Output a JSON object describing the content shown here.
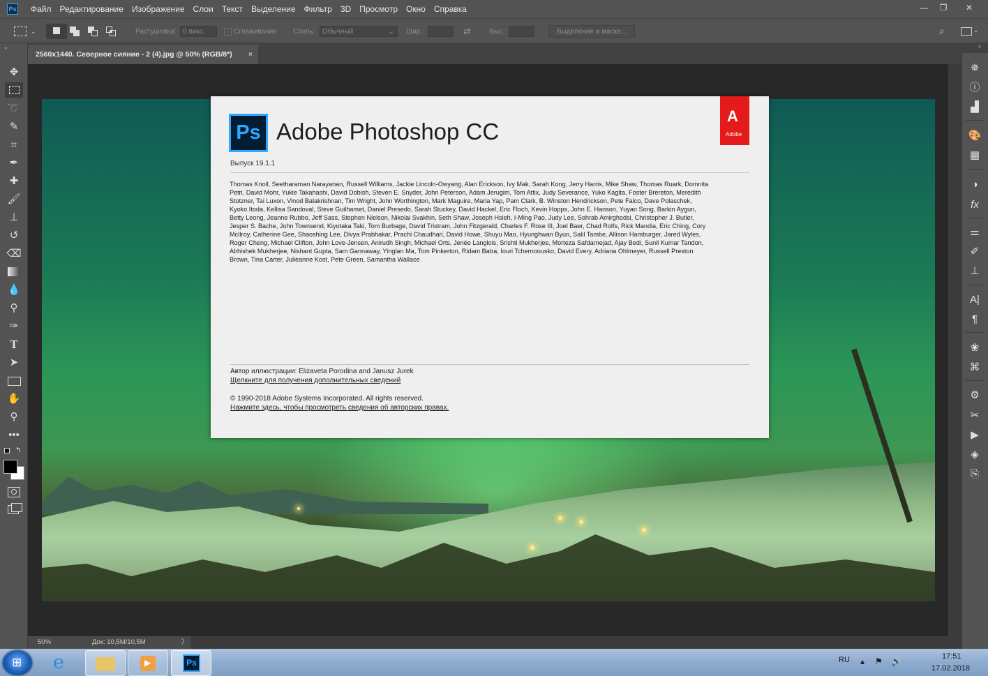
{
  "app": {
    "icon": "Ps",
    "accent": "#31a8ff"
  },
  "menu": [
    "Файл",
    "Редактирование",
    "Изображение",
    "Слои",
    "Текст",
    "Выделение",
    "Фильтр",
    "3D",
    "Просмотр",
    "Окно",
    "Справка"
  ],
  "window_controls": {
    "minimize": "—",
    "restore": "❐",
    "close": "✕"
  },
  "options": {
    "feather_label": "Растушевка:",
    "feather_value": "0 пикс.",
    "antialias_label": "Сглаживание",
    "style_label": "Стиль:",
    "style_value": "Обычный",
    "width_label": "Шир.:",
    "height_label": "Выс.:",
    "select_mask_label": "Выделение и маска..."
  },
  "document": {
    "tab_title": "2560x1440. Северное сияние - 2 (4).jpg @ 50% (RGB/8*)",
    "tab_close": "×"
  },
  "status": {
    "zoom": "50%",
    "doc_size": "Док: 10,5M/10,5M",
    "arrow": "〉"
  },
  "about": {
    "logo_text": "Ps",
    "title": "Adobe Photoshop CC",
    "adobe_text": "Adobe",
    "version": "Выпуск 19.1.1",
    "credits": "Thomas Knoll, Seetharaman Narayanan, Russell Williams, Jackie Lincoln-Owyang, Alan Erickson, Ivy Mak, Sarah Kong, Jerry Harris, Mike Shaw, Thomas Ruark, Domnita Petri, David Mohr, Yukie Takahashi, David Dobish, Steven E. Snyder, John Peterson, Adam Jerugim, Tom Attix, Judy Severance, Yuko Kagita, Foster Brereton, Meredith Stotzner, Tai Luxon, Vinod Balakrishnan, Tim Wright, John Worthington, Mark Maguire, Maria Yap, Pam Clark, B. Winston Hendrickson, Pete Falco, Dave Polaschek, Kyoko Itoda, Kellisa Sandoval, Steve Guilhamet, Daniel Presedo, Sarah Stuckey, David Hackel, Eric Floch, Kevin Hopps, John E. Hanson, Yuyan Song, Barkin Aygun, Betty Leong, Jeanne Rubbo, Jeff Sass, Stephen Nielson, Nikolai Svakhin, Seth Shaw, Joseph Hsieh, I-Ming Pao, Judy Lee, Sohrab Amirghodsi, Christopher J. Butler, Jesper S. Bache, John Townsend, Kiyotaka Taki, Tom Burbage, David Tristram, John Fitzgerald, Charles F. Rose III, Joel Baer, Chad Rolfs, Rick Mandia, Eric Ching, Cory McIlroy, Catherine Gee, Shaoshing Lee, Divya Prabhakar, Prachi Chaudhari, David Howe, Shuyu Mao, Hyunghwan Byun, Salil Tambe, Allison Hamburger, Jared Wyles, Roger Cheng, Michael Clifton, John Love-Jensen, Anirudh Singh, Michael Orts, Jenée Langlois, Srishti Mukherjee, Morteza Safdarnejad, Ajay Bedi, Sunil Kumar Tandon, Abhishek Mukherjee, Nishant Gupta, Sam Gannaway, Yinglan Ma, Tom Pinkerton, Ridam Batra, Iouri Tchernoousko, David Every, Adriana Ohlmeyer, Russell Preston Brown, Tina Carter, Julieanne Kost, Pete Green, Samantha Wallace",
    "illustration": "Автор иллюстрации: Elizaveta Porodina and Janusz Jurek",
    "more_info_link": "Щелкните для получения дополнительных сведений",
    "copyright": "© 1990-2018 Adobe Systems Incorporated. All rights reserved.",
    "rights_link": "Нажмите здесь, чтобы просмотреть сведения об авторских правах."
  },
  "taskbar": {
    "lang": "RU",
    "time": "17:51",
    "date": "17.02.2018",
    "ps_label": "Ps"
  }
}
